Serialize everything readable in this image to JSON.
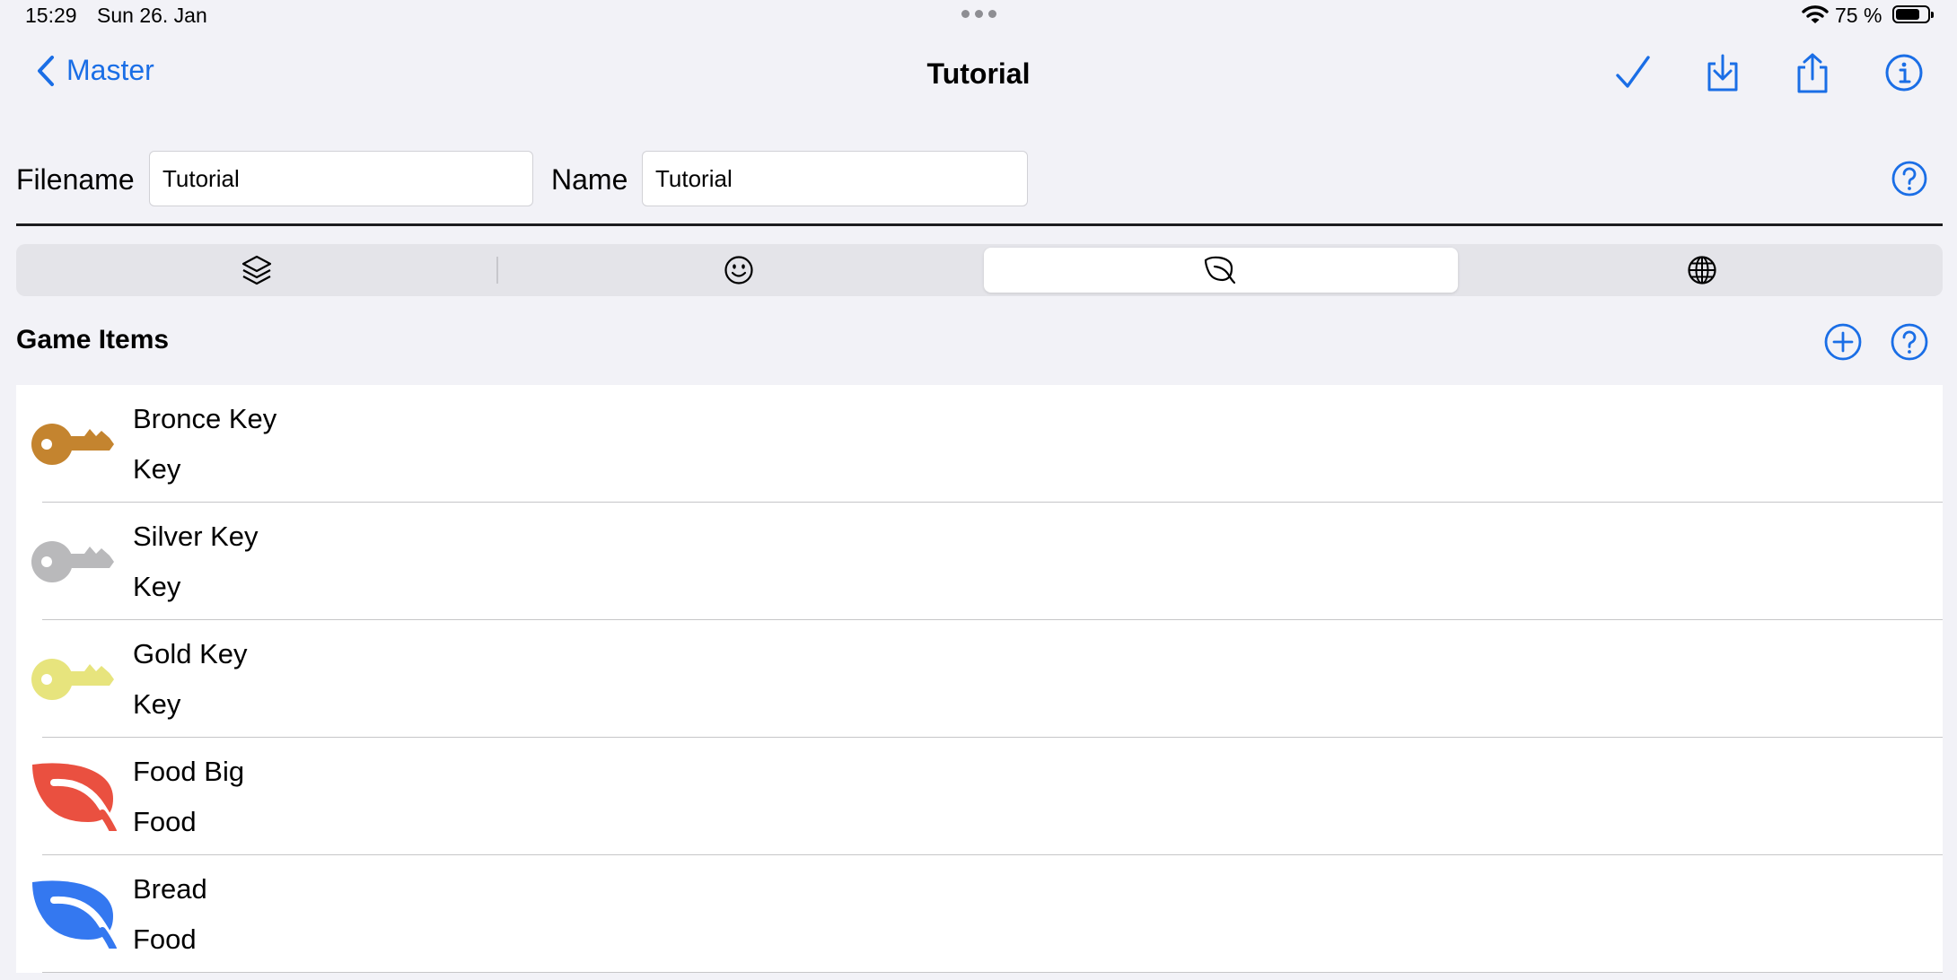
{
  "status_bar": {
    "time": "15:29",
    "date": "Sun 26. Jan",
    "battery_pct": "75 %",
    "battery_level": 0.75
  },
  "nav": {
    "back_label": "Master",
    "title": "Tutorial",
    "accent_color": "#1a6ee6",
    "icons": [
      "checkmark-icon",
      "download-icon",
      "share-icon",
      "info-icon"
    ]
  },
  "form": {
    "filename_label": "Filename",
    "filename_value": "Tutorial",
    "name_label": "Name",
    "name_value": "Tutorial"
  },
  "segments": {
    "selected_index": 2,
    "items": [
      {
        "icon": "layers-icon"
      },
      {
        "icon": "smiley-icon"
      },
      {
        "icon": "leaf-icon"
      },
      {
        "icon": "globe-icon"
      }
    ]
  },
  "section": {
    "title": "Game Items"
  },
  "items": [
    {
      "title": "Bronce Key",
      "subtitle": "Key",
      "icon": "key-icon",
      "color": "#c4842f"
    },
    {
      "title": "Silver Key",
      "subtitle": "Key",
      "icon": "key-icon",
      "color": "#b9b9bb"
    },
    {
      "title": "Gold Key",
      "subtitle": "Key",
      "icon": "key-icon",
      "color": "#e7e47d"
    },
    {
      "title": "Food Big",
      "subtitle": "Food",
      "icon": "leaf-icon",
      "color": "#ea5040"
    },
    {
      "title": "Bread",
      "subtitle": "Food",
      "icon": "leaf-icon",
      "color": "#3478f0"
    }
  ]
}
